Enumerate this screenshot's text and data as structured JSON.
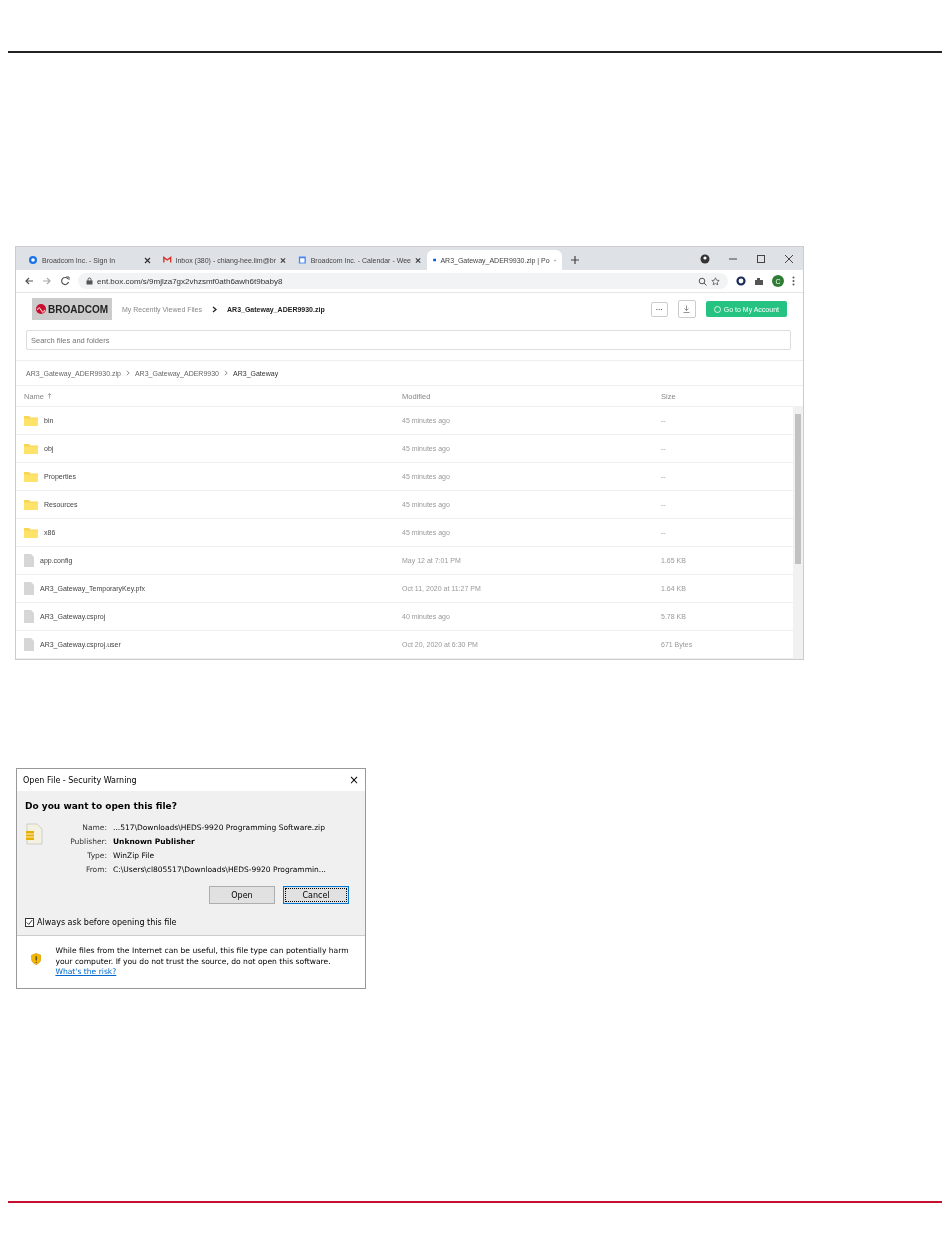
{
  "browser": {
    "tabs": [
      {
        "title": "Broadcom Inc. - Sign In",
        "selected": false
      },
      {
        "title": "Inbox (380) - chiang-hee.lim@br",
        "selected": false
      },
      {
        "title": "Broadcom Inc. - Calendar - Wee",
        "selected": false
      },
      {
        "title": "AR3_Gateway_ADER9930.zip | Po",
        "selected": true
      }
    ],
    "url": "ent.box.com/s/9mjlza7gx2vhzsmf0ath6awh6t9baby8",
    "avatar": "C",
    "header": {
      "logo": "BROADCOM",
      "breadcrumb": [
        "My Recently Viewed Files",
        "AR3_Gateway_ADER9930.zip"
      ],
      "more_button": "···",
      "account_button": "Go to My Account"
    },
    "search": {
      "placeholder": "Search files and folders"
    },
    "path": [
      "AR3_Gateway_ADER9930.zip",
      "AR3_Gateway_ADER9930",
      "AR3_Gateway"
    ],
    "columns": [
      "Name",
      "Modified",
      "Size"
    ],
    "rows": [
      {
        "kind": "folder",
        "name": "bin",
        "modified": "45 minutes ago",
        "size": "--"
      },
      {
        "kind": "folder",
        "name": "obj",
        "modified": "45 minutes ago",
        "size": "--"
      },
      {
        "kind": "folder",
        "name": "Properties",
        "modified": "45 minutes ago",
        "size": "--"
      },
      {
        "kind": "folder",
        "name": "Resources",
        "modified": "45 minutes ago",
        "size": "--"
      },
      {
        "kind": "folder",
        "name": "x86",
        "modified": "45 minutes ago",
        "size": "--"
      },
      {
        "kind": "file",
        "name": "app.config",
        "modified": "May 12 at 7:01 PM",
        "size": "1.65 KB"
      },
      {
        "kind": "file",
        "name": "AR3_Gateway_TemporaryKey.pfx",
        "modified": "Oct 11, 2020 at 11:27 PM",
        "size": "1.64 KB"
      },
      {
        "kind": "file",
        "name": "AR3_Gateway.csproj",
        "modified": "40 minutes ago",
        "size": "5.78 KB"
      },
      {
        "kind": "file",
        "name": "AR3_Gateway.csproj.user",
        "modified": "Oct 20, 2020 at 6:30 PM",
        "size": "671 Bytes"
      }
    ]
  },
  "dialog": {
    "title": "Open File - Security Warning",
    "close": "×",
    "question": "Do you want to open this file?",
    "fields": [
      {
        "label": "Name:",
        "value": "...517\\Downloads\\HEDS-9920 Programming Software.zip",
        "emphasis": false
      },
      {
        "label": "Publisher:",
        "value": "Unknown Publisher",
        "emphasis": true
      },
      {
        "label": "Type:",
        "value": "WinZip File",
        "emphasis": false
      },
      {
        "label": "From:",
        "value": "C:\\Users\\cl805517\\Downloads\\HEDS-9920 Programmin...",
        "emphasis": false
      }
    ],
    "buttons": [
      {
        "label": "Open",
        "focused": false
      },
      {
        "label": "Cancel",
        "focused": true
      }
    ],
    "checkbox": {
      "label": "Always ask before opening this file",
      "checked": true
    },
    "warning": {
      "text": "While files from the Internet can be useful, this file type can potentially harm your computer. If you do not trust the source, do not open this software.",
      "link": "What's the risk?"
    }
  }
}
